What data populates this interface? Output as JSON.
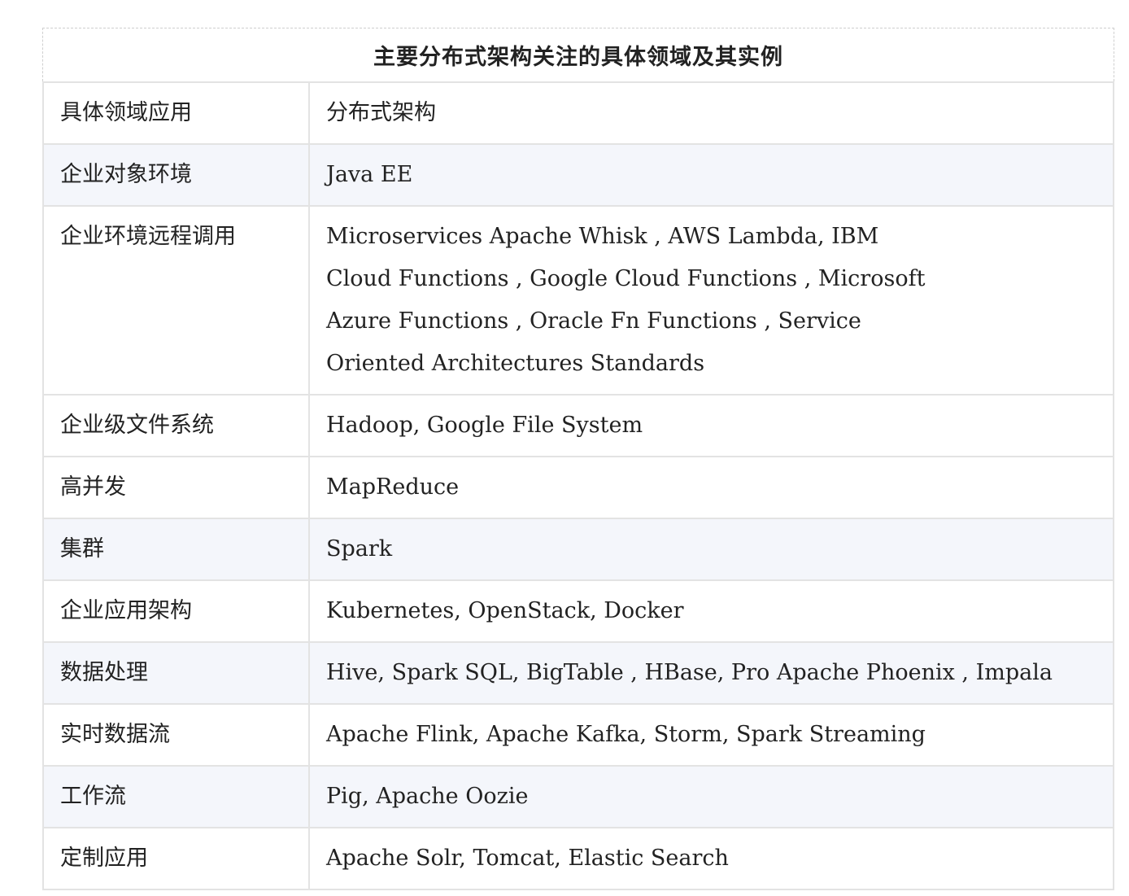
{
  "table": {
    "caption": "主要分布式架构关注的具体领域及其实例",
    "header": {
      "area": "具体领域应用",
      "framework": "分布式架构"
    },
    "rows": [
      {
        "area": "企业对象环境",
        "framework_lines": [
          "Java EE"
        ]
      },
      {
        "area": "企业环境远程调用",
        "framework_lines": [
          "Microservices  Apache Whisk , AWS Lambda, IBM",
          "Cloud Functions ,  Google Cloud Functions , Microsoft",
          "Azure Functions , Oracle Fn Functions , Service",
          "Oriented Architectures Standards"
        ]
      },
      {
        "area": "企业级文件系统",
        "framework_lines": [
          "Hadoop, Google File System"
        ]
      },
      {
        "area": "高并发",
        "framework_lines": [
          "MapReduce"
        ]
      },
      {
        "area": "集群",
        "framework_lines": [
          "Spark"
        ]
      },
      {
        "area": "企业应用架构",
        "framework_lines": [
          "Kubernetes, OpenStack, Docker"
        ]
      },
      {
        "area": "数据处理",
        "framework_lines": [
          "Hive, Spark SQL, BigTable , HBase, Pro Apache Phoenix ,  Impala"
        ]
      },
      {
        "area": "实时数据流",
        "framework_lines": [
          "Apache Flink, Apache Kafka, Storm, Spark Streaming"
        ]
      },
      {
        "area": "工作流",
        "framework_lines": [
          "Pig, Apache Oozie"
        ]
      },
      {
        "area": "定制应用",
        "framework_lines": [
          "Apache Solr, Tomcat, Elastic Search"
        ]
      }
    ]
  }
}
